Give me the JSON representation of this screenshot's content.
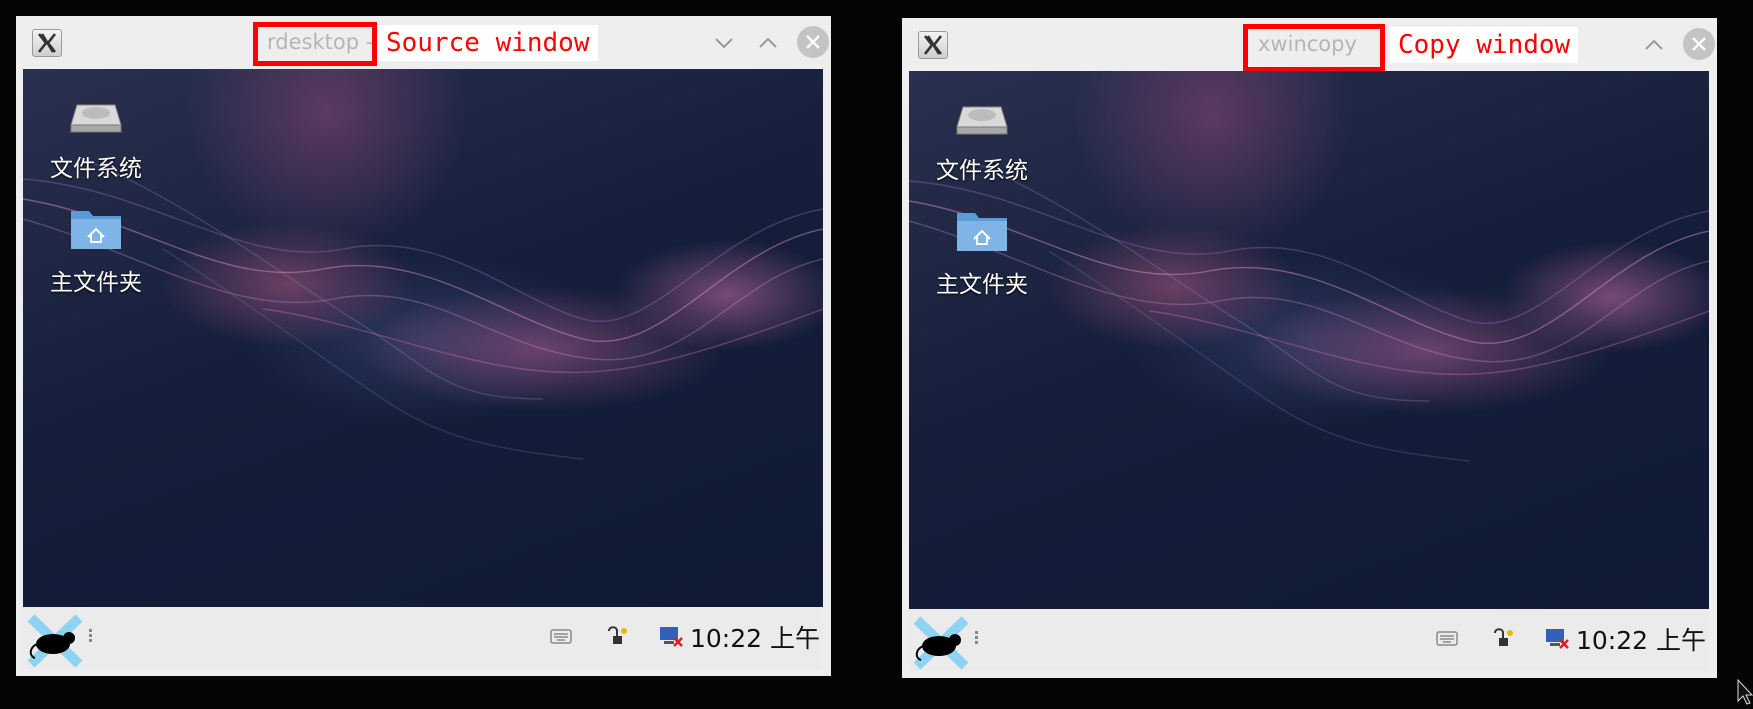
{
  "windows": {
    "source": {
      "title": "rdesktop -",
      "annotation": "Source window",
      "desktop_icons": [
        "文件系统",
        "主文件夹"
      ],
      "clock": "10:22 上午"
    },
    "copy": {
      "title": "xwincopy",
      "annotation": "Copy window",
      "desktop_icons": [
        "文件系统",
        "主文件夹"
      ],
      "clock": "10:22 上午"
    }
  },
  "icons": {
    "app": "x-window-system-icon",
    "minimize": "chevron-down-icon",
    "maximize": "chevron-up-icon",
    "close": "close-icon",
    "filesystem": "hard-drive-icon",
    "home": "home-folder-icon",
    "start": "xfce-mouse-icon",
    "keyboard": "keyboard-icon",
    "network": "network-plug-icon",
    "display": "display-disconnected-icon"
  },
  "colors": {
    "annotation_red": "#ff0000",
    "titlebar": "#eeeeef",
    "desktop_bg": "#151e3a"
  }
}
